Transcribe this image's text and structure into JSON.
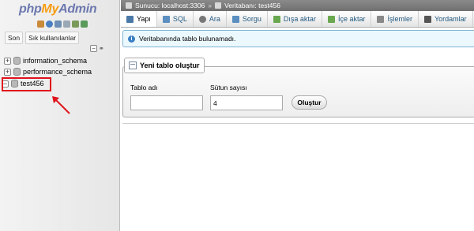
{
  "logo": {
    "php": "php",
    "my": "My",
    "admin": "Admin"
  },
  "left": {
    "tabs": [
      {
        "label": "Son"
      },
      {
        "label": "Sık kullanılanlar"
      }
    ],
    "collapse_symbol": "−",
    "databases": [
      {
        "name": "information_schema",
        "expander": "+"
      },
      {
        "name": "performance_schema",
        "expander": "+"
      },
      {
        "name": "test456",
        "expander": "−"
      }
    ]
  },
  "topbar": {
    "server_label": "Sunucu: localhost:3306",
    "separator": "»",
    "database_label": "Veritabanı: test456"
  },
  "tabs": [
    {
      "label": "Yapı",
      "icon": "structure-icon",
      "color": "#4a79a8"
    },
    {
      "label": "SQL",
      "icon": "sql-icon",
      "color": "#5a8fc0"
    },
    {
      "label": "Ara",
      "icon": "search-icon",
      "color": "#777777"
    },
    {
      "label": "Sorgu",
      "icon": "query-icon",
      "color": "#5a8fc0"
    },
    {
      "label": "Dışa aktar",
      "icon": "export-icon",
      "color": "#6aa84f"
    },
    {
      "label": "İçe aktar",
      "icon": "import-icon",
      "color": "#6aa84f"
    },
    {
      "label": "İşlemler",
      "icon": "wrench-icon",
      "color": "#888888"
    },
    {
      "label": "Yordamlar",
      "icon": "routines-icon",
      "color": "#555555"
    }
  ],
  "notice": {
    "icon_text": "i",
    "text": "Veritabanında tablo bulunamadı."
  },
  "create_table": {
    "legend": "Yeni tablo oluştur",
    "name_label": "Tablo adı",
    "name_value": "",
    "columns_label": "Sütun sayısı",
    "columns_value": "4",
    "go_label": "Oluştur"
  },
  "colors": {
    "annotation_red": "#e0131b",
    "link_blue": "#235a81",
    "logo_blue": "#6c78af",
    "logo_orange": "#f89c0e"
  }
}
